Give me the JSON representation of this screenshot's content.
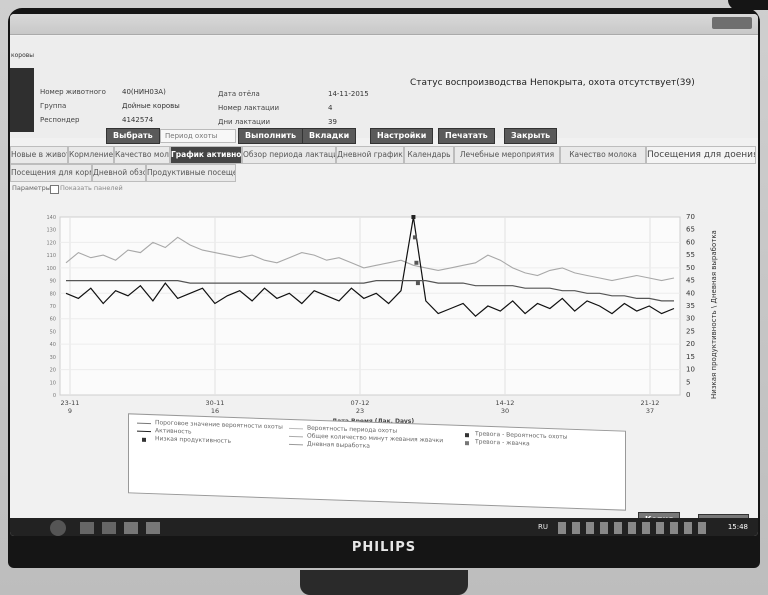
{
  "window": {
    "title": ""
  },
  "panel": {
    "title": "коровы"
  },
  "info": {
    "cow_number_label": "Номер животного",
    "cow_number_value": "40(НИН03А)",
    "group_label": "Группа",
    "group_value": "Дойные коровы",
    "responder_label": "Респондер",
    "responder_value": "4142574",
    "calving_date_label": "Дата отёла",
    "calving_date_value": "14-11-2015",
    "lactation_number_label": "Номер лактации",
    "lactation_number_value": "4",
    "lactation_days_label": "Дни лактации",
    "lactation_days_value": "39",
    "repro_status_label": "Статус воспроизводства :",
    "repro_status_value": "Непокрыта, охота отсутствует(39)"
  },
  "buttons": {
    "select": "Выбрать",
    "period_placeholder": "Период охоты",
    "execute": "Выполнить",
    "tabs_btn": "Вкладки",
    "settings": "Настройки",
    "print": "Печатать",
    "close": "Закрыть"
  },
  "tabs_row1": [
    "Новые в животные",
    "Кормление",
    "Качество молока",
    "График активности",
    "Обзор периода лактации",
    "Дневной график",
    "Календарь",
    "Лечебные мероприятия",
    "Качество молока",
    "Посещения для доения"
  ],
  "tabs_row2": [
    "Посещения для кормления",
    "Дневной обзор",
    "Продуктивные посещения"
  ],
  "subbar": {
    "params": "Параметры",
    "show_panel": "Показать панелей"
  },
  "chart_data": {
    "type": "line",
    "title": "",
    "xlabel": "Дата Время (Лак. Days)",
    "ylabel_left": "",
    "ylabel_right": "Низкая продуктивность \\ Дневная выработка",
    "x": [
      "23-11",
      "30-11",
      "07-12",
      "14-12",
      "21-12"
    ],
    "x_sublabels": [
      "9",
      "16",
      "23",
      "30",
      "37"
    ],
    "ylim_right": [
      0,
      70
    ],
    "right_ticks": [
      0,
      5,
      10,
      15,
      20,
      25,
      30,
      35,
      40,
      45,
      50,
      55,
      60,
      65,
      70
    ],
    "left_ticks": [
      140,
      130,
      120,
      110,
      100,
      90,
      80,
      70,
      60,
      50,
      40,
      30,
      20,
      10,
      0
    ],
    "series": [
      {
        "name": "Общее количество минут жевания жвачки",
        "values": [
          52,
          56,
          54,
          55,
          53,
          57,
          56,
          60,
          58,
          62,
          59,
          57,
          56,
          55,
          54,
          55,
          53,
          52,
          54,
          56,
          55,
          53,
          54,
          52,
          50,
          51,
          52,
          53,
          51,
          50,
          49,
          50,
          51,
          52,
          55,
          53,
          50,
          48,
          47,
          49,
          50,
          48,
          47,
          46,
          45,
          46,
          47,
          46,
          45,
          46
        ]
      },
      {
        "name": "Активность",
        "values": [
          40,
          38,
          42,
          36,
          41,
          39,
          43,
          37,
          44,
          38,
          40,
          42,
          36,
          39,
          41,
          37,
          42,
          38,
          40,
          36,
          41,
          39,
          37,
          42,
          38,
          40,
          36,
          41,
          70,
          37,
          32,
          34,
          36,
          31,
          35,
          33,
          37,
          32,
          36,
          34,
          38,
          33,
          37,
          35,
          32,
          36,
          33,
          35,
          32,
          34
        ]
      },
      {
        "name": "Порог вероятности охоты",
        "values": [
          45,
          45,
          45,
          45,
          45,
          45,
          45,
          45,
          45,
          45,
          44,
          44,
          44,
          44,
          44,
          44,
          44,
          44,
          44,
          44,
          44,
          44,
          44,
          44,
          44,
          45,
          45,
          45,
          45,
          45,
          44,
          44,
          44,
          43,
          43,
          43,
          43,
          42,
          42,
          42,
          41,
          41,
          40,
          40,
          39,
          39,
          38,
          38,
          37,
          37
        ]
      }
    ]
  },
  "legend": {
    "items": [
      "Пороговое значение вероятности охоты",
      "Активность",
      "Низкая продуктивность",
      "Вероятность периода охоты",
      "Общее количество минут жевания жвачки",
      "Дневная выработка",
      "Тревога - Вероятность охоты",
      "Тревога - жвачка"
    ]
  },
  "bottom_buttons": {
    "copy": "Копия",
    "export": "Экспорт"
  },
  "taskbar": {
    "lang": "RU",
    "time": "15:48"
  },
  "brand": "PHILIPS",
  "colors": {
    "accent": "#444444",
    "button": "#5a5a5a",
    "bg": "#f1f1f1"
  }
}
